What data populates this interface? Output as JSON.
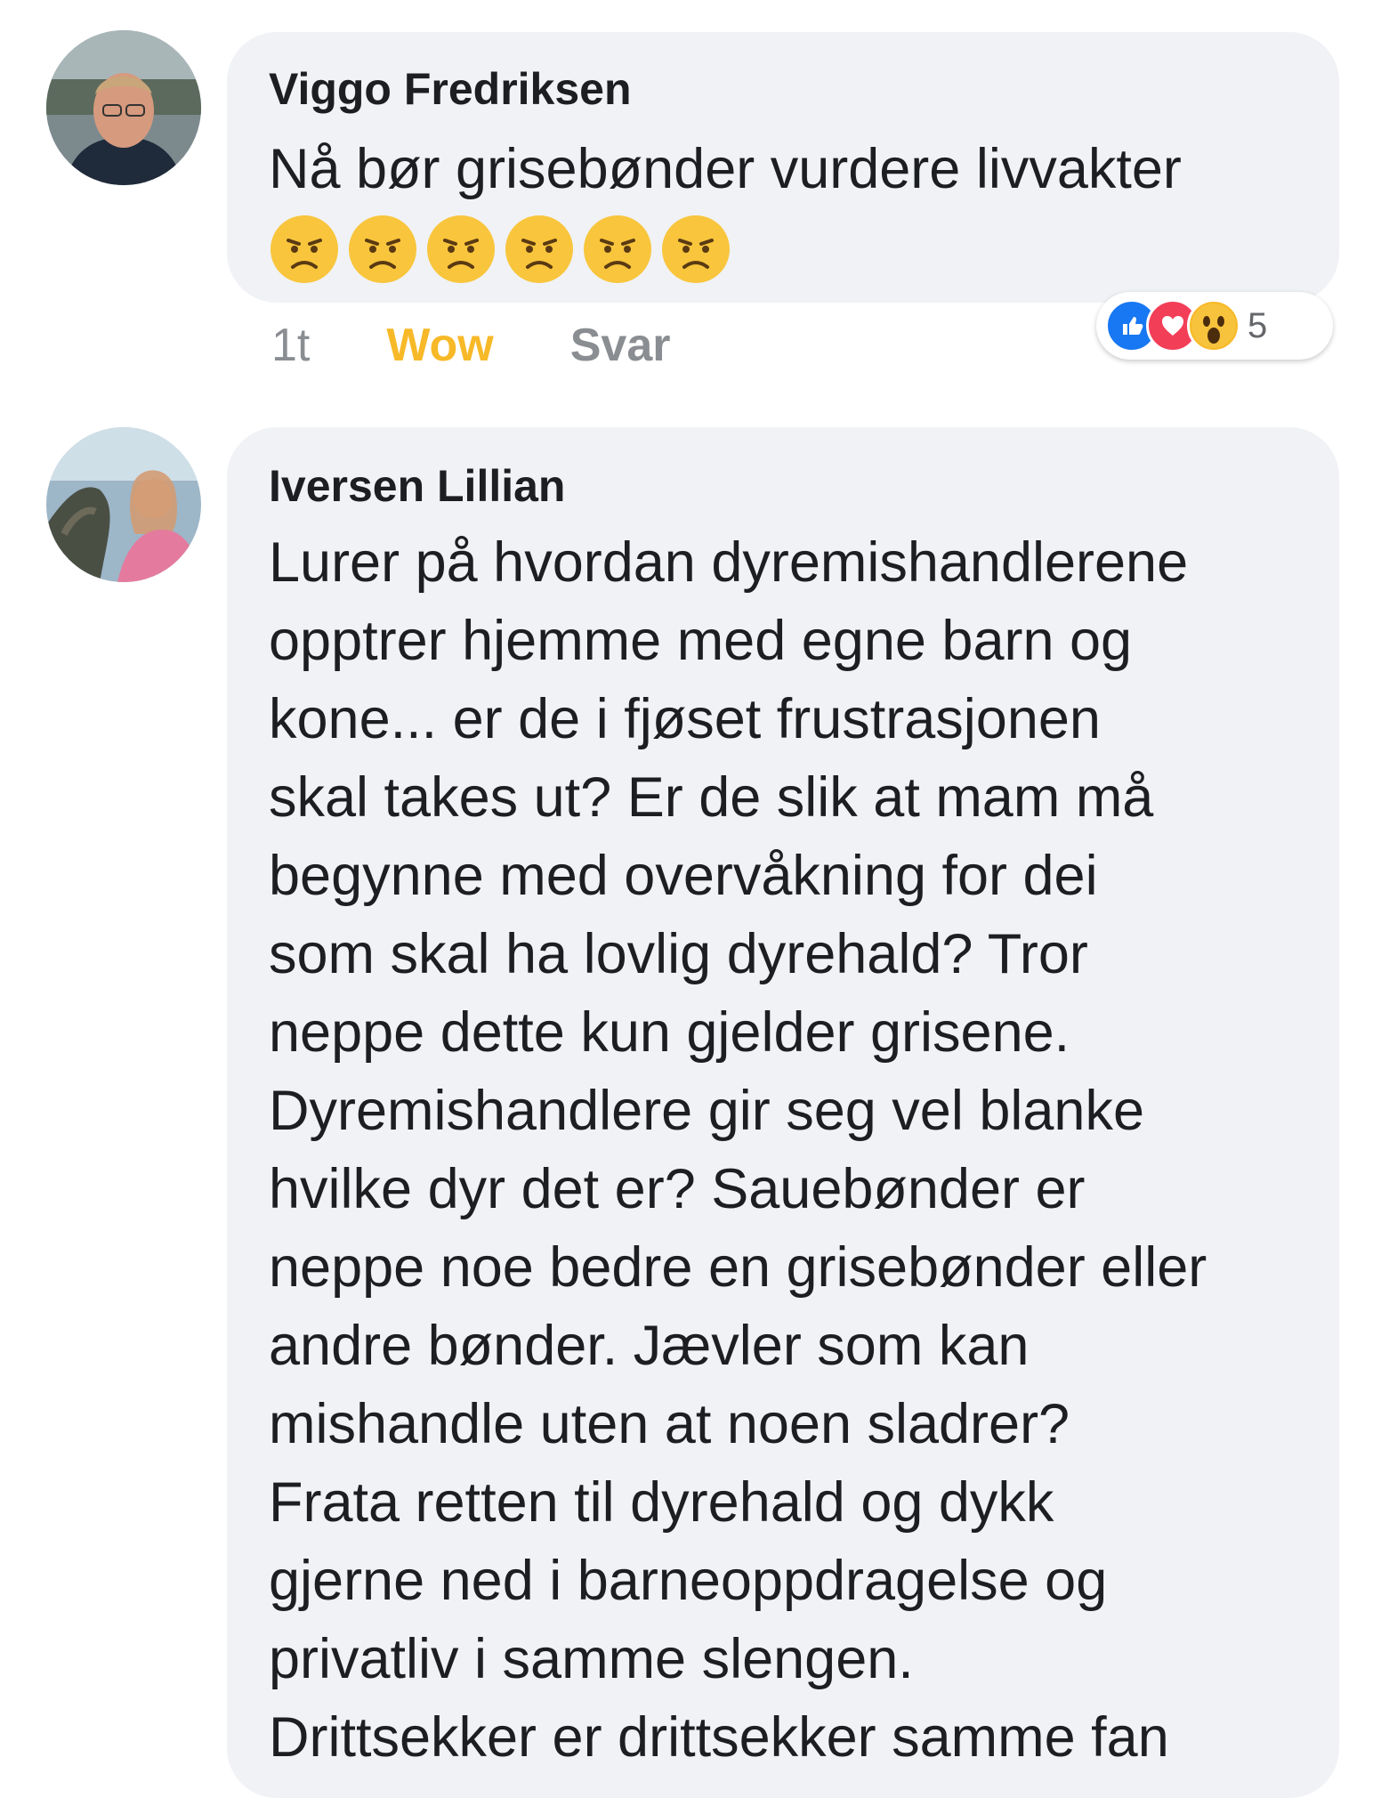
{
  "comments": [
    {
      "author": "Viggo Fredriksen",
      "text_lines": [
        "Nå bør grisebønder vurdere livvakter"
      ],
      "emojis": [
        "frowning-face",
        "frowning-face",
        "frowning-face",
        "frowning-face",
        "frowning-face",
        "frowning-face"
      ],
      "actions": {
        "time": "1t",
        "reaction": "Wow",
        "reply": "Svar"
      },
      "reactions": {
        "icons": [
          "like-icon",
          "love-icon",
          "wow-icon"
        ],
        "count": "5"
      }
    },
    {
      "author": "Iversen Lillian",
      "text_lines": [
        "Lurer på hvordan dyremishandlerene",
        "opptrer hjemme med egne barn og",
        "kone... er de i fjøset frustrasjonen",
        "skal takes ut? Er de slik at mam må",
        "begynne med overvåkning for dei",
        "som skal ha lovlig dyrehald? Tror",
        "neppe dette kun gjelder grisene.",
        "Dyremishandlere gir seg vel blanke",
        "hvilke dyr det er? Sauebønder er",
        "neppe noe bedre en grisebønder eller",
        "andre bønder. Jævler som kan",
        "mishandle uten at noen sladrer?",
        "Frata retten til dyrehald og dykk",
        "gjerne ned i barneoppdragelse og",
        "privatliv i samme slengen.",
        "Drittsekker er drittsekker samme fan"
      ]
    }
  ],
  "colors": {
    "bubble": "#f0f2f5",
    "text": "#1c1e21",
    "meta": "#8a8d91",
    "wow": "#f7b928",
    "like": "#1877f2",
    "love": "#f33e58"
  }
}
